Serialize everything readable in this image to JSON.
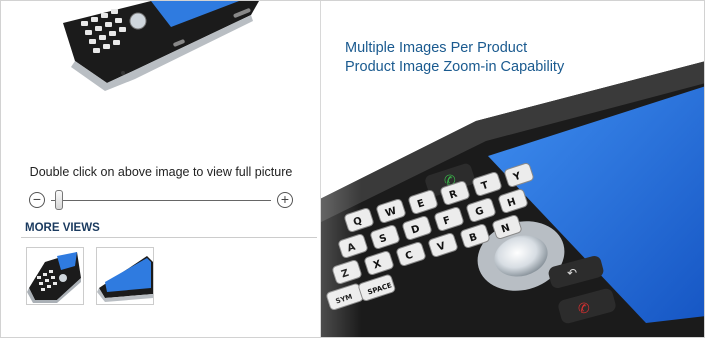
{
  "promo": {
    "line1": "Multiple Images Per Product",
    "line2": "Product Image Zoom-in Capability"
  },
  "product": {
    "zoom_hint": "Double click on above image to view full picture",
    "zoom_minus": "−",
    "zoom_plus": "+",
    "zoom_level": 0,
    "more_views_label": "MORE VIEWS",
    "thumbnails": [
      "thumbnail-view-1",
      "thumbnail-view-2"
    ]
  },
  "keypad_labels": [
    "Q",
    "W",
    "E",
    "R",
    "T",
    "Y",
    "A",
    "S",
    "D",
    "F",
    "G",
    "H",
    "Z",
    "X",
    "C",
    "V",
    "B",
    "N",
    "SYM",
    "SPACE"
  ],
  "colors": {
    "accent_text": "#1a5a8f",
    "heading": "#1a3a5f",
    "screen_blue": "#1f6fd6"
  }
}
